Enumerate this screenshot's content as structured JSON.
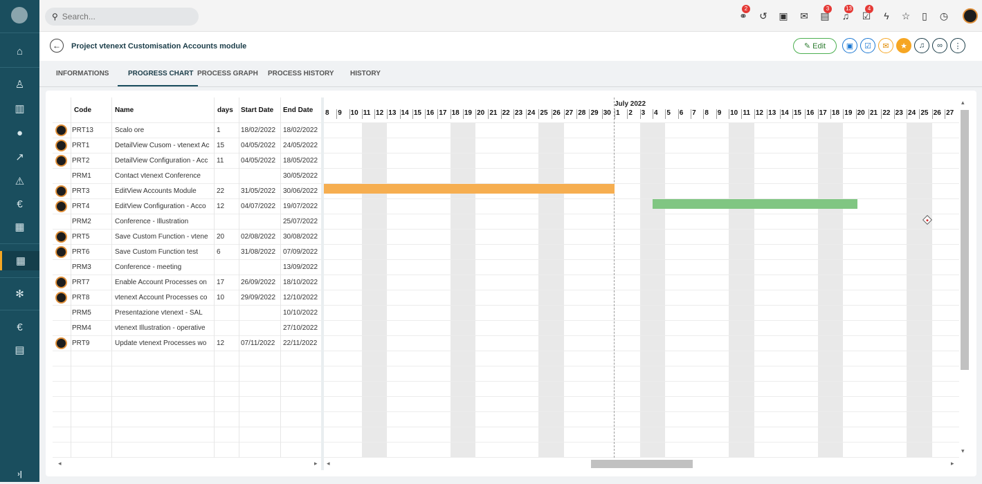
{
  "search": {
    "placeholder": "Search..."
  },
  "topbar": {
    "icons": [
      {
        "name": "processes-icon",
        "badge": "2"
      },
      {
        "name": "history-icon",
        "badge": ""
      },
      {
        "name": "calendar-icon",
        "badge": ""
      },
      {
        "name": "mail-icon",
        "badge": ""
      },
      {
        "name": "chat-icon",
        "badge": "3"
      },
      {
        "name": "bell-icon",
        "badge": "13"
      },
      {
        "name": "todo-icon",
        "badge": "4"
      },
      {
        "name": "quick-create-icon",
        "badge": ""
      },
      {
        "name": "star-icon",
        "badge": ""
      },
      {
        "name": "document-icon",
        "badge": ""
      },
      {
        "name": "timer-icon",
        "badge": ""
      }
    ]
  },
  "page": {
    "title": "Project vtenext Customisation Accounts module",
    "edit_label": "Edit"
  },
  "tabs": [
    {
      "label": "INFORMATIONS"
    },
    {
      "label": "PROGRESS CHART"
    },
    {
      "label": "PROCESS GRAPH"
    },
    {
      "label": "PROCESS HISTORY"
    },
    {
      "label": "HISTORY"
    }
  ],
  "grid": {
    "headers": {
      "code": "Code",
      "name": "Name",
      "days": "days",
      "start": "Start Date",
      "end": "End Date"
    },
    "rows": [
      {
        "avatar": true,
        "code": "PRT13",
        "name": "Scalo ore",
        "days": "1",
        "start": "18/02/2022",
        "end": "18/02/2022"
      },
      {
        "avatar": true,
        "code": "PRT1",
        "name": "DetailView Cusom - vtenext Ac",
        "days": "15",
        "start": "04/05/2022",
        "end": "24/05/2022"
      },
      {
        "avatar": true,
        "code": "PRT2",
        "name": "DetailView Configuration - Acc",
        "days": "11",
        "start": "04/05/2022",
        "end": "18/05/2022"
      },
      {
        "avatar": false,
        "code": "PRM1",
        "name": "Contact vtenext Conference",
        "days": "",
        "start": "",
        "end": "30/05/2022"
      },
      {
        "avatar": true,
        "code": "PRT3",
        "name": "EditView Accounts Module",
        "days": "22",
        "start": "31/05/2022",
        "end": "30/06/2022"
      },
      {
        "avatar": true,
        "code": "PRT4",
        "name": "EditView Configuration - Acco",
        "days": "12",
        "start": "04/07/2022",
        "end": "19/07/2022"
      },
      {
        "avatar": false,
        "code": "PRM2",
        "name": "Conference - Illustration",
        "days": "",
        "start": "",
        "end": "25/07/2022"
      },
      {
        "avatar": true,
        "code": "PRT5",
        "name": "Save Custom Function - vtene",
        "days": "20",
        "start": "02/08/2022",
        "end": "30/08/2022"
      },
      {
        "avatar": true,
        "code": "PRT6",
        "name": "Save Custom Function test",
        "days": "6",
        "start": "31/08/2022",
        "end": "07/09/2022"
      },
      {
        "avatar": false,
        "code": "PRM3",
        "name": "Conference - meeting",
        "days": "",
        "start": "",
        "end": "13/09/2022"
      },
      {
        "avatar": true,
        "code": "PRT7",
        "name": "Enable Account Processes on",
        "days": "17",
        "start": "26/09/2022",
        "end": "18/10/2022"
      },
      {
        "avatar": true,
        "code": "PRT8",
        "name": "vtenext Account Processes co",
        "days": "10",
        "start": "29/09/2022",
        "end": "12/10/2022"
      },
      {
        "avatar": false,
        "code": "PRM5",
        "name": "Presentazione vtenext - SAL",
        "days": "",
        "start": "",
        "end": "10/10/2022"
      },
      {
        "avatar": false,
        "code": "PRM4",
        "name": "vtenext Illustration - operative",
        "days": "",
        "start": "",
        "end": "27/10/2022"
      },
      {
        "avatar": true,
        "code": "PRT9",
        "name": "Update vtenext Processes wo",
        "days": "12",
        "start": "07/11/2022",
        "end": "22/11/2022"
      }
    ]
  },
  "gantt": {
    "month_label": "July 2022",
    "days": [
      "8",
      "9",
      "10",
      "11",
      "12",
      "13",
      "14",
      "15",
      "16",
      "17",
      "18",
      "19",
      "20",
      "21",
      "22",
      "23",
      "24",
      "25",
      "26",
      "27",
      "28",
      "29",
      "30",
      "1",
      "2",
      "3",
      "4",
      "5",
      "6",
      "7",
      "8",
      "9",
      "10",
      "11",
      "12",
      "13",
      "14",
      "15",
      "16",
      "17",
      "18",
      "19",
      "20",
      "21",
      "22",
      "23",
      "24",
      "25",
      "26",
      "27"
    ],
    "colors": {
      "bar_in_progress": "#f6ae50",
      "bar_planned": "#80c682",
      "milestone_dot": "#d32f2f"
    }
  }
}
